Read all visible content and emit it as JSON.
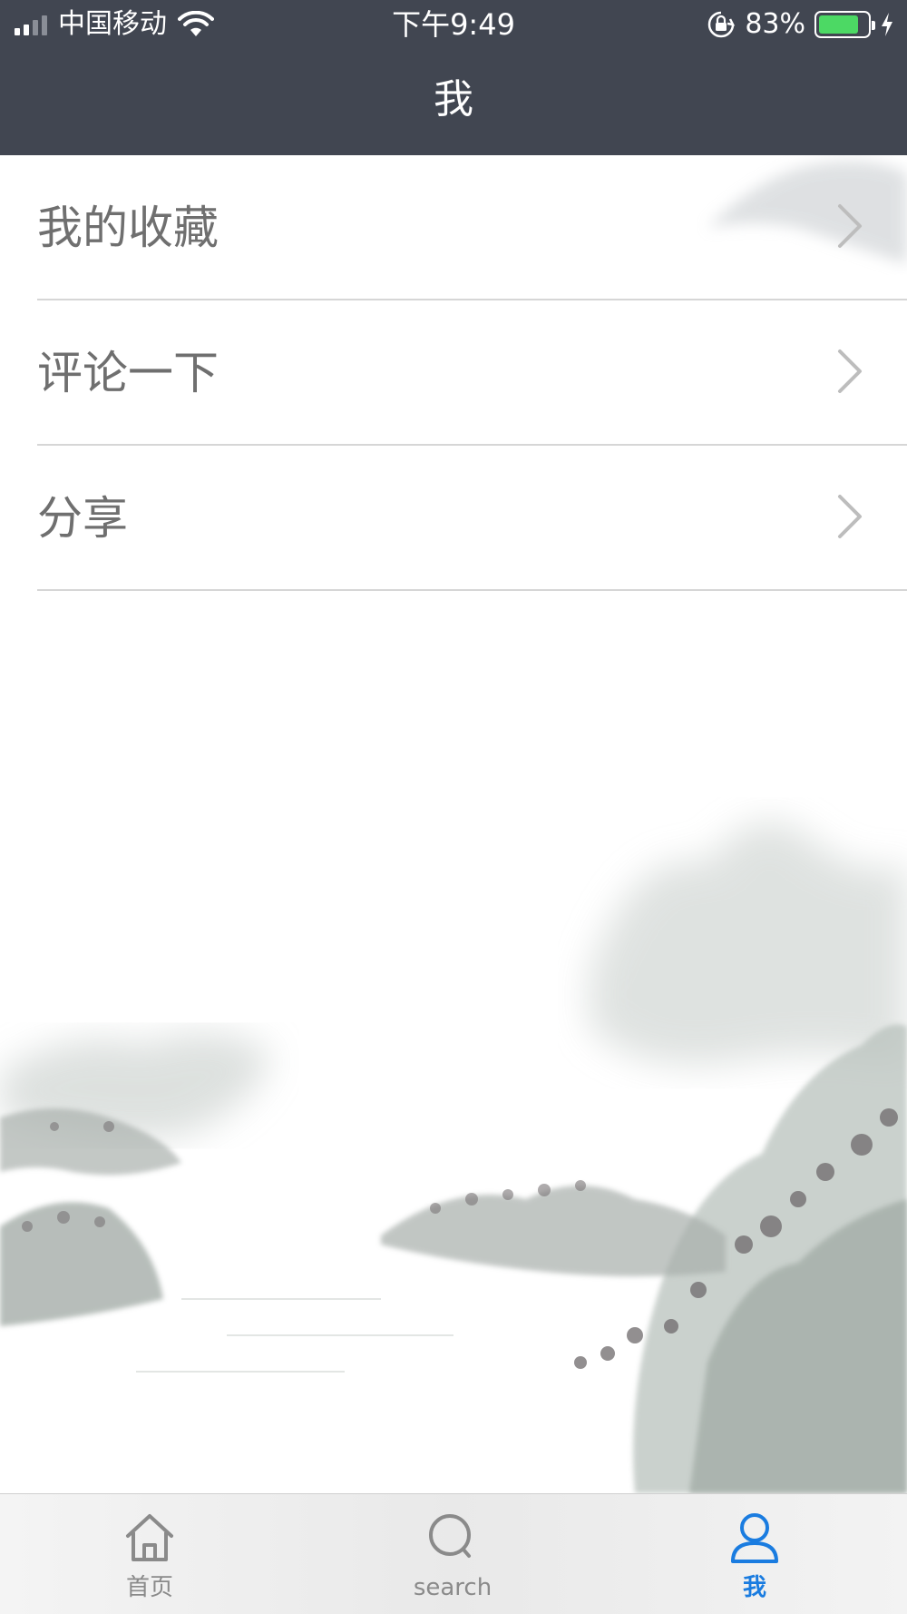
{
  "status_bar": {
    "carrier": "中国移动",
    "time": "下午9:49",
    "battery_percent": "83%",
    "battery_level": 0.83,
    "battery_color": "#4cd964"
  },
  "header": {
    "title": "我",
    "background": "#414651"
  },
  "menu": {
    "items": [
      {
        "label": "我的收藏",
        "icon": "chevron-right-icon"
      },
      {
        "label": "评论一下",
        "icon": "chevron-right-icon"
      },
      {
        "label": "分享",
        "icon": "chevron-right-icon"
      }
    ]
  },
  "tabbar": {
    "tabs": [
      {
        "label": "首页",
        "icon": "home-icon",
        "active": false
      },
      {
        "label": "search",
        "icon": "search-icon",
        "active": false
      },
      {
        "label": "我",
        "icon": "person-icon",
        "active": true
      }
    ],
    "active_color": "#1a7ce0",
    "inactive_color": "#8a8a8a"
  }
}
